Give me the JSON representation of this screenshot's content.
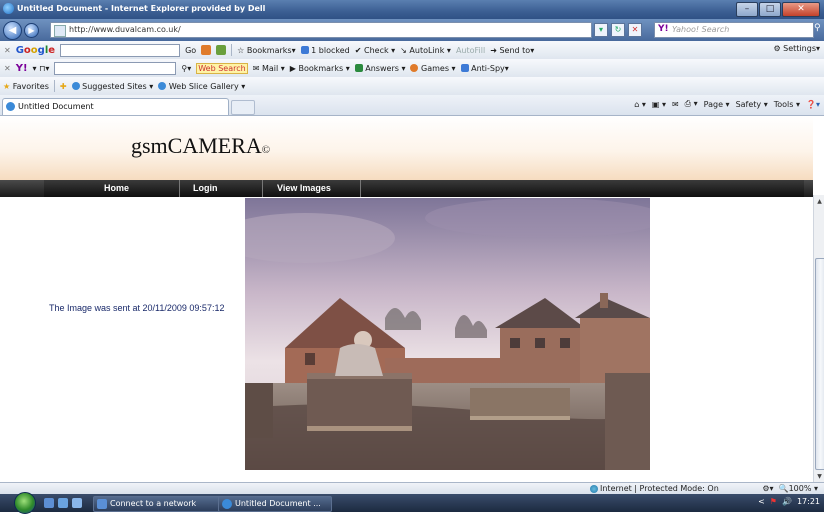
{
  "window": {
    "title": "Untitled Document - Internet Explorer provided by Dell"
  },
  "address": {
    "url": "http://www.duvalcam.co.uk/",
    "search_placeholder": "Yahoo! Search"
  },
  "google_toolbar": {
    "logo": "Google",
    "go": "Go",
    "bookmarks": "Bookmarks",
    "blocked": "1 blocked",
    "check": "Check",
    "autolink": "AutoLink",
    "autofill": "AutoFill",
    "send_to": "Send to",
    "settings": "Settings"
  },
  "yahoo_toolbar": {
    "web_search": "Web Search",
    "mail": "Mail",
    "bookmarks": "Bookmarks",
    "answers": "Answers",
    "games": "Games",
    "anti_spy": "Anti-Spy"
  },
  "favorites_bar": {
    "favorites": "Favorites",
    "suggested_sites": "Suggested Sites",
    "web_slice_gallery": "Web Slice Gallery"
  },
  "tab": {
    "label": "Untitled Document"
  },
  "command_bar": {
    "page": "Page",
    "safety": "Safety",
    "tools": "Tools"
  },
  "page": {
    "logo": "gsmCAMERA",
    "logo_mark": "©",
    "nav": [
      "Home",
      "Login",
      "View Images"
    ],
    "image_sent_text": "The Image was sent at 20/11/2009 09:57:12"
  },
  "status": {
    "zone": "Internet | Protected Mode: On",
    "zoom": "100%"
  },
  "taskbar": {
    "items": [
      "Connect to a network",
      "Untitled Document ..."
    ],
    "clock": "17:21"
  },
  "colors": {
    "accent": "#3c5f93",
    "nav_bg": "#1a1a1a",
    "banner_fade": "#f6dcc0",
    "message_text": "#1a2a6a"
  },
  "icons": [
    "ie-icon",
    "back-icon",
    "forward-icon",
    "refresh-icon",
    "stop-icon",
    "search-icon",
    "home-icon",
    "feeds-icon",
    "mail-icon",
    "print-icon",
    "help-icon",
    "start-icon"
  ]
}
